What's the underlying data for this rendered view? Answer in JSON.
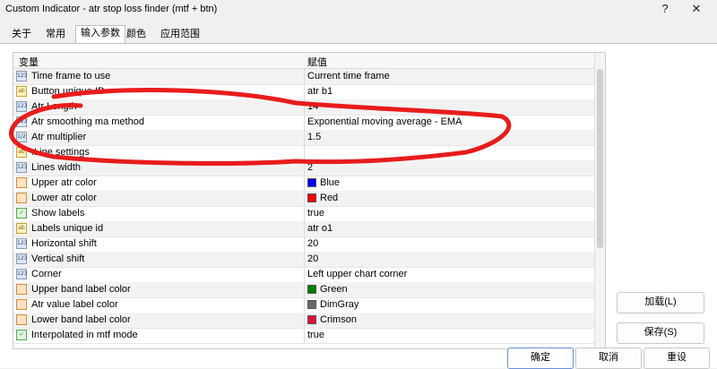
{
  "window": {
    "title": "Custom Indicator - atr stop loss finder (mtf + btn)",
    "help": "?",
    "close": "✕"
  },
  "tabs": [
    {
      "label": "关于"
    },
    {
      "label": "常用"
    },
    {
      "label": "输入参数"
    },
    {
      "label": "颜色"
    },
    {
      "label": "应用范围"
    }
  ],
  "table": {
    "col_name": "变量",
    "col_value": "赋值",
    "rows": [
      {
        "type": "123",
        "name": "Time frame to use",
        "value": "Current time frame"
      },
      {
        "type": "ab",
        "name": "Button unique ID",
        "value": "atr b1"
      },
      {
        "type": "123",
        "name": "Atr Length",
        "value": "14"
      },
      {
        "type": "123",
        "name": "Atr smoothing ma method",
        "value": "Exponential moving average - EMA"
      },
      {
        "type": "1/2",
        "name": "Atr multiplier",
        "value": "1.5"
      },
      {
        "type": "ab",
        "name": ".Line settings",
        "value": ""
      },
      {
        "type": "123",
        "name": "Lines width",
        "value": "2"
      },
      {
        "type": "color",
        "name": "Upper atr color",
        "value": "Blue",
        "swatch": "#0000ff"
      },
      {
        "type": "color",
        "name": "Lower atr color",
        "value": "Red",
        "swatch": "#ff0000"
      },
      {
        "type": "bool",
        "name": "Show labels",
        "value": "true"
      },
      {
        "type": "ab",
        "name": "Labels unique id",
        "value": "atr o1"
      },
      {
        "type": "123",
        "name": "Horizontal shift",
        "value": "20"
      },
      {
        "type": "123",
        "name": "Vertical shift",
        "value": "20"
      },
      {
        "type": "123",
        "name": "Corner",
        "value": "Left upper chart corner"
      },
      {
        "type": "color",
        "name": "Upper band label color",
        "value": "Green",
        "swatch": "#008000"
      },
      {
        "type": "color",
        "name": "Atr value label color",
        "value": "DimGray",
        "swatch": "#696969"
      },
      {
        "type": "color",
        "name": "Lower band label color",
        "value": "Crimson",
        "swatch": "#dc143c"
      },
      {
        "type": "bool",
        "name": "Interpolated in mtf mode",
        "value": "true"
      }
    ]
  },
  "buttons": {
    "load": "加载(L)",
    "save": "保存(S)",
    "ok": "确定",
    "cancel": "取消",
    "reset": "重设"
  },
  "annotation": {
    "color": "#e81c1c"
  }
}
